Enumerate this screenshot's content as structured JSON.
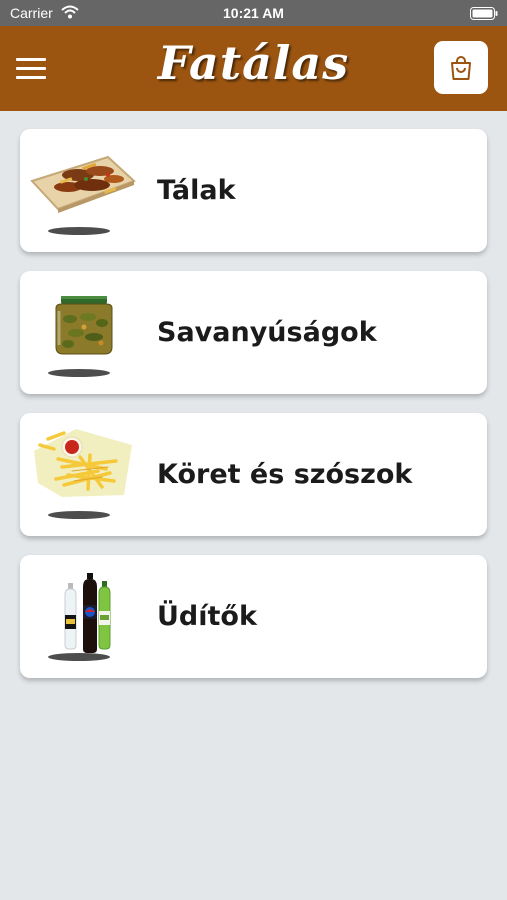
{
  "status_bar": {
    "carrier": "Carrier",
    "time": "10:21 AM",
    "icons": [
      "wifi-icon",
      "battery-icon"
    ]
  },
  "header": {
    "logo": "Fatálas",
    "menu_icon": "hamburger-menu-icon",
    "cart_icon": "shopping-bag-icon",
    "background_color": "#9b5511"
  },
  "categories": [
    {
      "label": "Tálak",
      "image": "platter-image"
    },
    {
      "label": "Savanyúságok",
      "image": "pickle-jar-image"
    },
    {
      "label": "Köret és szószok",
      "image": "fries-with-ketchup-image"
    },
    {
      "label": "Üdítők",
      "image": "soda-bottles-image"
    }
  ],
  "colors": {
    "page_background": "#e3e7ea",
    "card_background": "#ffffff",
    "status_bar": "#666666"
  }
}
